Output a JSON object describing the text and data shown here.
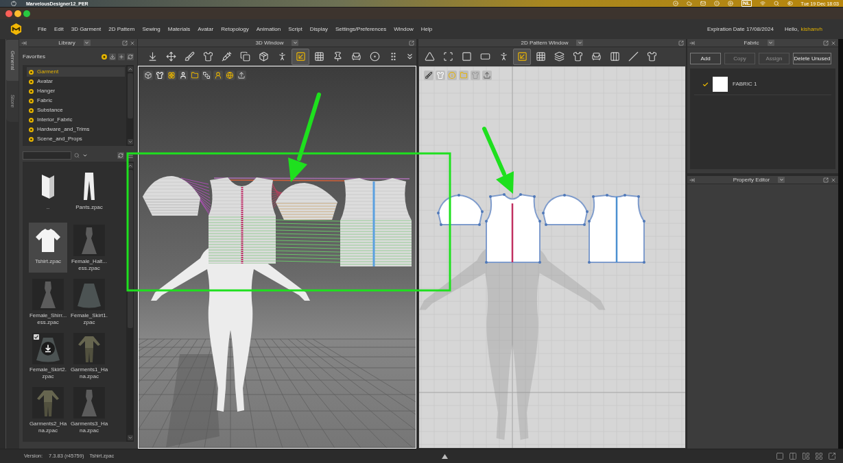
{
  "os_menubar": {
    "app_name": "MarvelousDesigner12_PER",
    "input_source": "NL",
    "clock": "Tue 19 Dec 18:03"
  },
  "app_menu": {
    "items": [
      "File",
      "Edit",
      "3D Garment",
      "2D Pattern",
      "Sewing",
      "Materials",
      "Avatar",
      "Retopology",
      "Animation",
      "Script",
      "Display",
      "Settings/Preferences",
      "Window",
      "Help"
    ],
    "expiration": "Expiration Date 17/08/2024",
    "greeting": "Hello,",
    "user": "kishanvh"
  },
  "side_tabs": [
    {
      "label": "General",
      "selected": true
    },
    {
      "label": "Store",
      "selected": false
    }
  ],
  "library": {
    "title": "Library",
    "favorites_label": "Favorites",
    "tree": [
      {
        "label": "Garment",
        "selected": true
      },
      {
        "label": "Avatar",
        "selected": false
      },
      {
        "label": "Hanger",
        "selected": false
      },
      {
        "label": "Fabric",
        "selected": false
      },
      {
        "label": "Substance",
        "selected": false
      },
      {
        "label": "Interior_Fabric",
        "selected": false
      },
      {
        "label": "Hardware_and_Trims",
        "selected": false
      },
      {
        "label": "Scene_and_Props",
        "selected": false
      }
    ],
    "items": [
      {
        "label": "..",
        "kind": "folder",
        "selected": false,
        "checked": false,
        "download": false
      },
      {
        "label": "Pants.zpac",
        "kind": "pants",
        "selected": false,
        "checked": false,
        "download": false
      },
      {
        "label": "Tshirt.zpac",
        "kind": "tshirt",
        "selected": true,
        "checked": false,
        "download": false
      },
      {
        "label": "Female_Halt...ess.zpac",
        "kind": "dress",
        "selected": false,
        "checked": false,
        "download": false
      },
      {
        "label": "Female_Shirr...ess.zpac",
        "kind": "dress",
        "selected": false,
        "checked": false,
        "download": false
      },
      {
        "label": "Female_Skirt1.zpac",
        "kind": "skirt",
        "selected": false,
        "checked": false,
        "download": false
      },
      {
        "label": "Female_Skirt2.zpac",
        "kind": "skirt",
        "selected": false,
        "checked": true,
        "download": true
      },
      {
        "label": "Garments1_Hana.zpac",
        "kind": "outfit",
        "selected": false,
        "checked": false,
        "download": false
      },
      {
        "label": "Garments2_Hana.zpac",
        "kind": "outfit",
        "selected": false,
        "checked": false,
        "download": false
      },
      {
        "label": "Garments3_Hana.zpac",
        "kind": "dress",
        "selected": false,
        "checked": false,
        "download": false
      }
    ]
  },
  "window_3d": {
    "title": "3D Window",
    "active": true,
    "tools": [
      {
        "kind": "drop",
        "selected": false
      },
      {
        "kind": "move",
        "selected": false
      },
      {
        "kind": "brush",
        "selected": false
      },
      {
        "kind": "garment",
        "selected": false
      },
      {
        "kind": "needle",
        "selected": false
      },
      {
        "kind": "pair",
        "selected": false
      },
      {
        "kind": "box",
        "selected": false
      },
      {
        "kind": "avatar",
        "selected": false
      },
      {
        "kind": "sew",
        "selected": true
      },
      {
        "kind": "grid",
        "selected": false
      },
      {
        "kind": "pin",
        "selected": false
      },
      {
        "kind": "chair",
        "selected": false
      },
      {
        "kind": "button",
        "selected": false
      },
      {
        "kind": "zipper",
        "selected": false
      }
    ]
  },
  "window_2d": {
    "title": "2D Pattern Window",
    "active": false,
    "tools": [
      {
        "kind": "triangle",
        "selected": false
      },
      {
        "kind": "points",
        "selected": false
      },
      {
        "kind": "shape",
        "selected": false
      },
      {
        "kind": "rectangle",
        "selected": false
      },
      {
        "kind": "avatar",
        "selected": false
      },
      {
        "kind": "sew",
        "selected": true
      },
      {
        "kind": "grid",
        "selected": false
      },
      {
        "kind": "iron",
        "selected": false
      },
      {
        "kind": "garment",
        "selected": false
      },
      {
        "kind": "chair",
        "selected": false
      },
      {
        "kind": "panels",
        "selected": false
      },
      {
        "kind": "line",
        "selected": false
      },
      {
        "kind": "garment",
        "selected": false
      }
    ]
  },
  "fabric_panel": {
    "title": "Fabric",
    "buttons": [
      {
        "label": "Add",
        "disabled": false
      },
      {
        "label": "Copy",
        "disabled": true
      },
      {
        "label": "Assign",
        "disabled": true
      },
      {
        "label": "Delete Unused",
        "disabled": false
      }
    ],
    "fabrics": [
      {
        "name": "FABRIC 1",
        "checked": true,
        "color": "#ffffff"
      }
    ]
  },
  "property_editor": {
    "title": "Property Editor"
  },
  "status_bar": {
    "version_label": "Version:",
    "version": "7.3.83 (r45759)",
    "file": "Tshirt.zpac"
  }
}
